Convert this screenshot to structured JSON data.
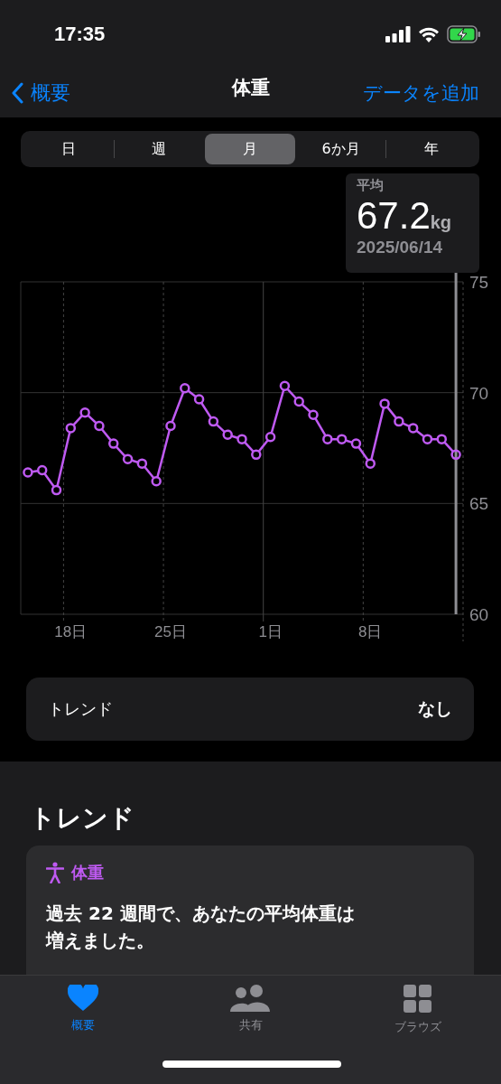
{
  "status_bar": {
    "time": "17:35"
  },
  "nav": {
    "back": "概要",
    "title": "体重",
    "action": "データを追加"
  },
  "segments": [
    {
      "label": "日",
      "selected": false
    },
    {
      "label": "週",
      "selected": false
    },
    {
      "label": "月",
      "selected": true
    },
    {
      "label": "6か月",
      "selected": false
    },
    {
      "label": "年",
      "selected": false
    }
  ],
  "summary": {
    "label": "平均",
    "value": "67.2",
    "unit": "kg",
    "date": "2025/06/14"
  },
  "chart_data": {
    "type": "line",
    "categories": [
      null,
      null,
      null,
      "18日",
      null,
      null,
      null,
      null,
      null,
      null,
      "25日",
      null,
      null,
      null,
      null,
      null,
      null,
      "1日",
      null,
      null,
      null,
      null,
      null,
      null,
      "8日",
      null,
      null,
      null,
      null,
      null,
      null
    ],
    "series": [
      {
        "marker": "circle",
        "color": "#bf5af2",
        "values": [
          66.4,
          66.5,
          65.6,
          68.4,
          69.1,
          68.5,
          67.7,
          67.0,
          66.8,
          66.0,
          68.5,
          70.2,
          69.7,
          68.7,
          68.1,
          67.9,
          67.2,
          68.0,
          70.3,
          69.6,
          69.0,
          67.9,
          67.9,
          67.7,
          66.8,
          69.5,
          68.7,
          68.4,
          67.9,
          67.9,
          67.2
        ]
      }
    ],
    "grid": true,
    "ylim": [
      60,
      75
    ],
    "yticks": [
      60,
      65,
      70,
      75
    ]
  },
  "trend_row": {
    "label": "トレンド",
    "value": "なし"
  },
  "trends_section": {
    "heading": "トレンド",
    "card": {
      "category": "体重",
      "text": "過去 22 週間で、あなたの平均体重は増えました。"
    }
  },
  "tab_bar": [
    {
      "kind": "heart",
      "label": "概要",
      "selected": true
    },
    {
      "kind": "people",
      "label": "共有",
      "selected": false
    },
    {
      "kind": "grid",
      "label": "ブラウズ",
      "selected": false
    }
  ]
}
